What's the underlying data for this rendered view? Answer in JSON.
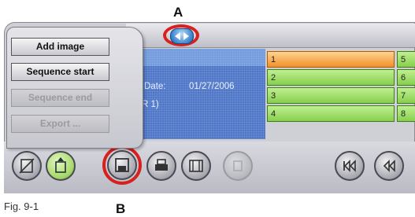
{
  "callouts": {
    "a": "A",
    "b": "B"
  },
  "caption": "Fig. 9-1",
  "menu": {
    "items": [
      {
        "label": "Add image",
        "enabled": true
      },
      {
        "label": "Sequence start",
        "enabled": true
      },
      {
        "label": "Sequence end",
        "enabled": false
      },
      {
        "label": "Export ...",
        "enabled": false
      }
    ]
  },
  "info": {
    "date_label": "Date:",
    "date_value": "01/27/2006",
    "partial_text": "R 1)"
  },
  "sequence": {
    "cells_left": [
      "1",
      "2",
      "3",
      "4"
    ],
    "cells_right": [
      "5",
      "6",
      "7",
      "8"
    ],
    "selected": "1"
  },
  "toolbar": {
    "buttons": [
      "delete-image",
      "import-image",
      "save",
      "print",
      "film",
      "blank"
    ],
    "nav": [
      "first",
      "previous"
    ]
  },
  "colors": {
    "accent_red": "#d8201f",
    "panel_blue": "#4f77c8",
    "cell_green": "#9ad964",
    "cell_selected": "#f0912c"
  }
}
